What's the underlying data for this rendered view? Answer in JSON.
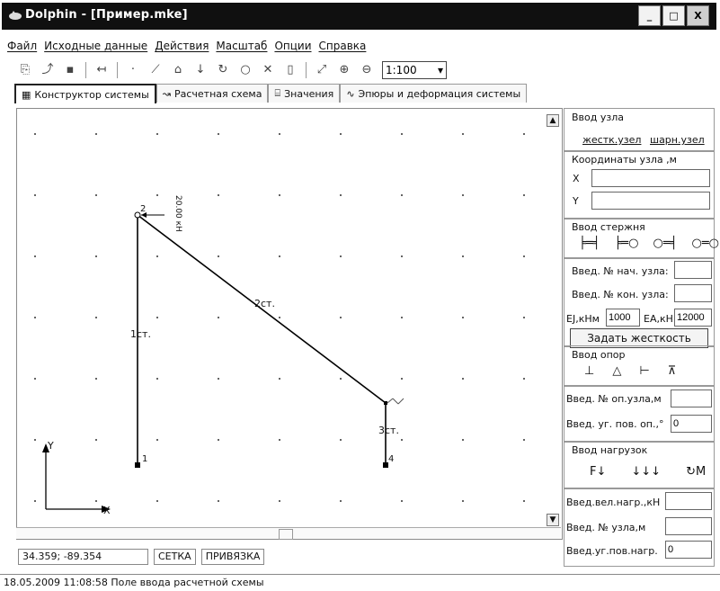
{
  "window": {
    "title": "Dolphin - [Пример.mke]",
    "buttons": {
      "minimize": "_",
      "maximize": "□",
      "close": "X"
    }
  },
  "menu": [
    "Файл",
    "Исходные данные",
    "Действия",
    "Масштаб",
    "Опции",
    "Справка"
  ],
  "toolbar": {
    "zoom_value": "1:100"
  },
  "tabs": [
    "Конструктор системы",
    "Расчетная схема",
    "Значения",
    "Эпюры и деформация системы"
  ],
  "canvas": {
    "nodes": [
      "1",
      "2",
      "4"
    ],
    "rods": [
      "1ст.",
      "2ст.",
      "3ст."
    ],
    "load_label": "20.00 кН",
    "axis_x": "X",
    "axis_y": "Y"
  },
  "status": {
    "coords": "34.359; -89.354",
    "grid": "СЕТКА",
    "snap": "ПРИВЯЗКА"
  },
  "bottom_status": "18.05.2009 11:08:58   Поле ввода расчетной схемы",
  "panel": {
    "node_title": "Ввод узла",
    "rigid_node": "жестк.узел",
    "hinge_node": "шарн.узел",
    "coords_title": "Координаты узла ,м",
    "x_label": "X",
    "y_label": "Y",
    "rod_title": "Ввод стержня",
    "start_node_label": "Введ. № нач. узла:",
    "end_node_label": "Введ. № кон. узла:",
    "ej_label": "EJ,кНм",
    "ej_value": "1000",
    "ea_label": "EA,кН",
    "ea_value": "12000",
    "set_stiffness": "Задать жесткость",
    "supports_title": "Ввод опор",
    "support_node_label": "Введ. № оп.узла,м",
    "support_angle_label": "Введ. уг. пов. оп.,°",
    "support_angle_value": "0",
    "loads_title": "Ввод нагрузок",
    "load_value_label": "Введ.вел.нагр.,кН",
    "load_node_label": "Введ. № узла,м",
    "load_angle_label": "Введ.уг.пов.нагр.",
    "load_angle_value": "0"
  }
}
